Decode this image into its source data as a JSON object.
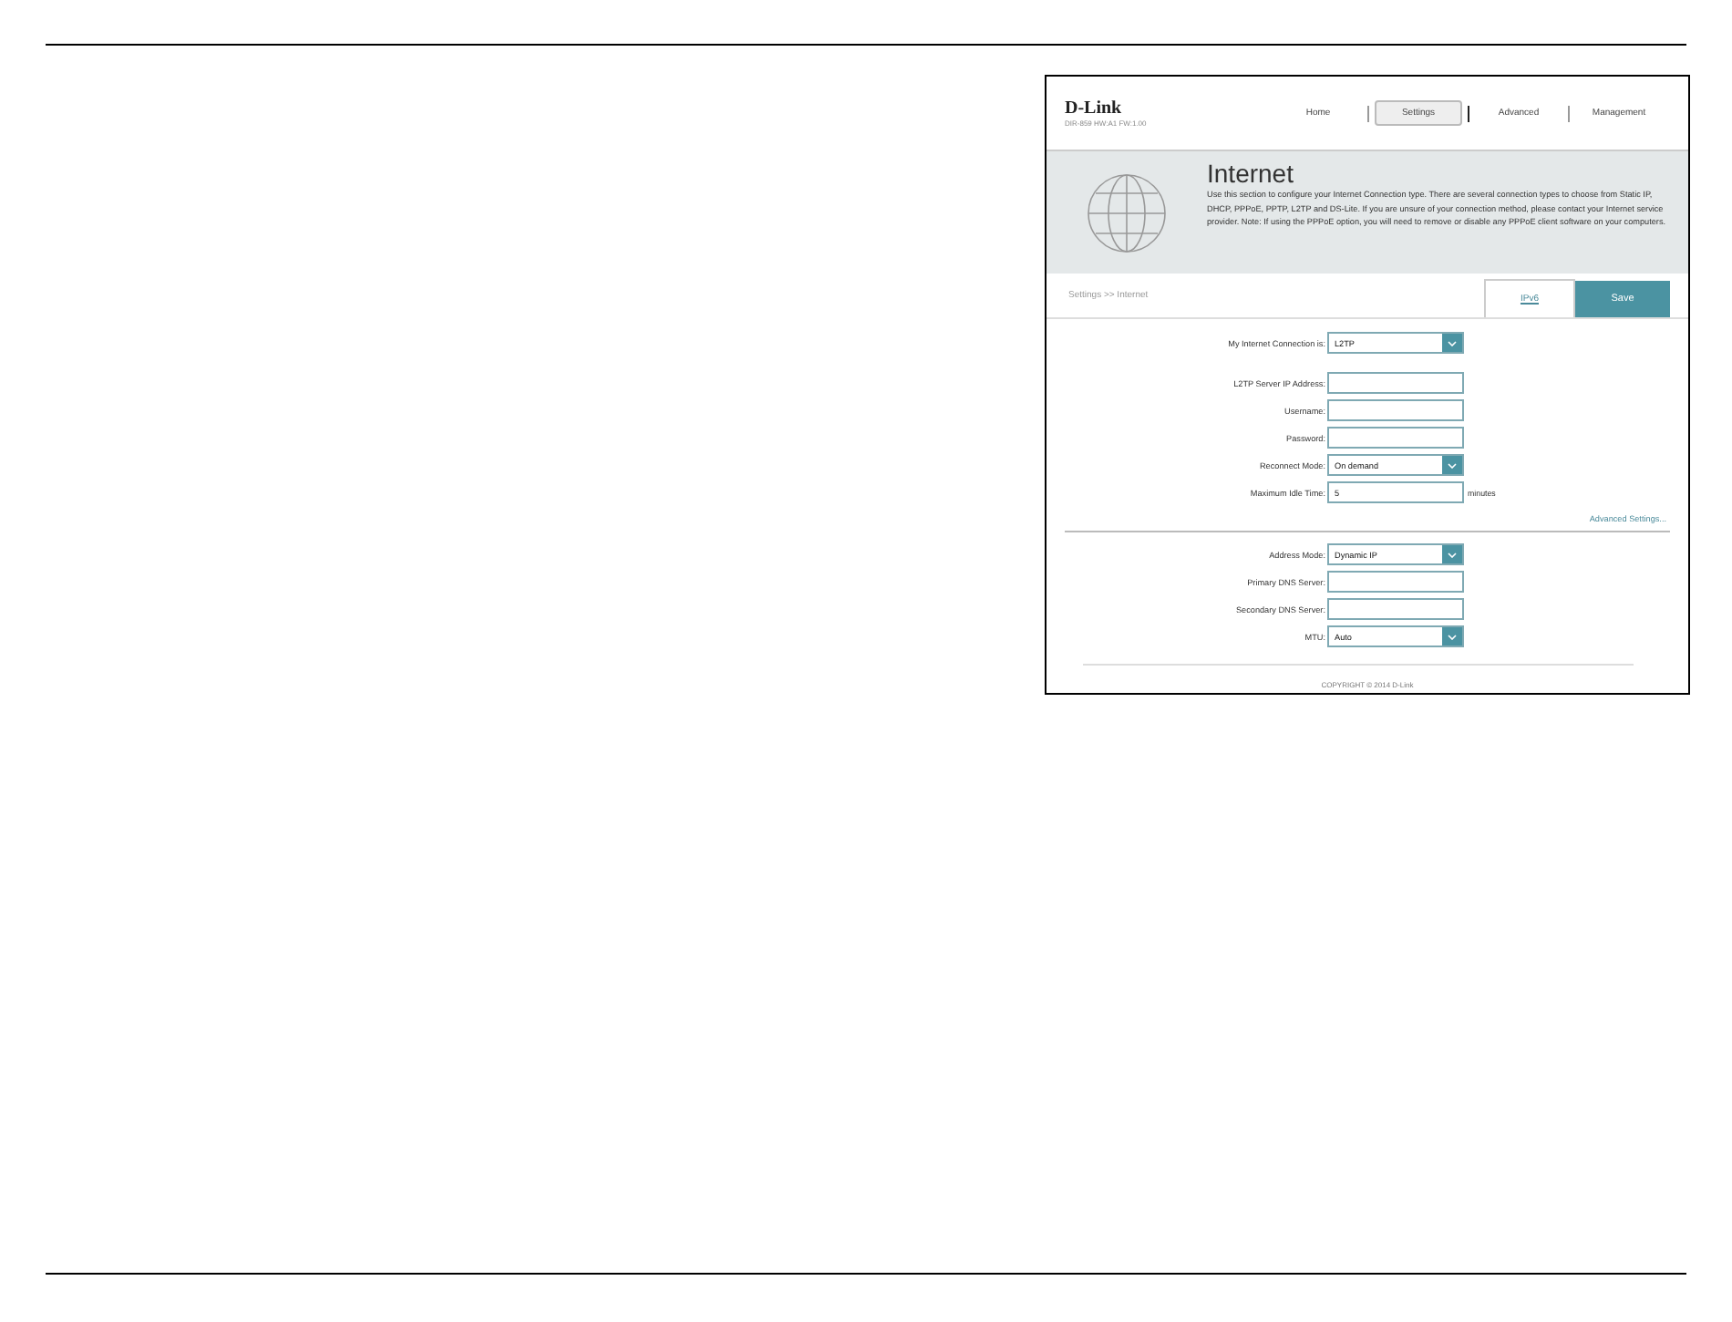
{
  "router_ui": {
    "brand": "D-Link",
    "model_info": "DIR-859   HW:A1   FW:1.00",
    "nav": [
      {
        "label": "Home",
        "selected": false
      },
      {
        "label": "Settings",
        "selected": true
      },
      {
        "label": "Advanced",
        "selected": false
      },
      {
        "label": "Management",
        "selected": false
      }
    ],
    "banner": {
      "title": "Internet",
      "description": "Use this section to configure your Internet Connection type. There are several connection types to choose from Static IP, DHCP, PPPoE, PPTP, L2TP and DS-Lite. If you are unsure of your connection method, please contact your Internet service provider. Note: If using the PPPoE option, you will need to remove or disable any PPPoE client software on your computers."
    },
    "breadcrumb": "Settings >> Internet",
    "ipv6_link": "IPv6",
    "save_button": "Save",
    "fields": [
      {
        "kind": "select",
        "label": "My Internet Connection is:",
        "value": "L2TP"
      },
      {
        "kind": "gap"
      },
      {
        "kind": "text",
        "label": "L2TP Server IP Address:"
      },
      {
        "kind": "text",
        "label": "Username:"
      },
      {
        "kind": "text",
        "label": "Password:"
      },
      {
        "kind": "select",
        "label": "Reconnect Mode:",
        "value": "On demand"
      },
      {
        "kind": "text",
        "label": "Maximum Idle Time:",
        "value": "5",
        "unit": "minutes"
      }
    ],
    "advanced_link": "Advanced Settings...",
    "fields_2": [
      {
        "kind": "select",
        "label": "Address Mode:",
        "value": "Dynamic IP"
      },
      {
        "kind": "text",
        "label": "Primary DNS Server:"
      },
      {
        "kind": "text",
        "label": "Secondary DNS Server:"
      },
      {
        "kind": "select",
        "label": "MTU:",
        "value": "Auto"
      }
    ],
    "copyright": "COPYRIGHT © 2014 D-Link"
  }
}
